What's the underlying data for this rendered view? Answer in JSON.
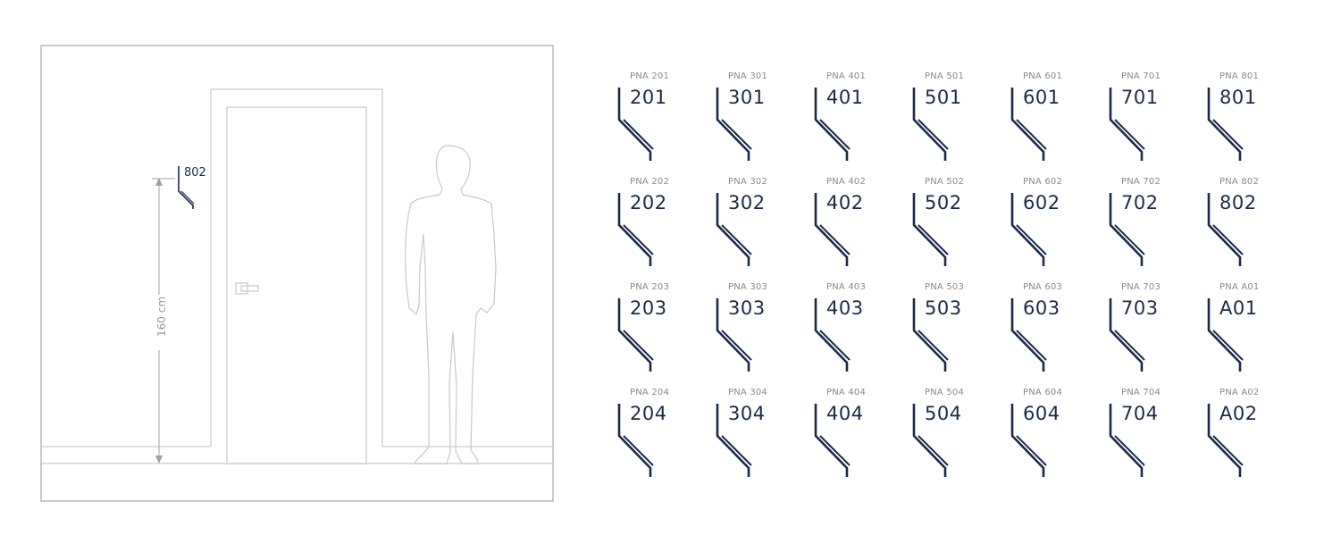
{
  "elevation": {
    "mounted_sign_number": "802",
    "height_label": "160 cm"
  },
  "signs": [
    [
      "PNA 201",
      "201"
    ],
    [
      "PNA 301",
      "301"
    ],
    [
      "PNA 401",
      "401"
    ],
    [
      "PNA 501",
      "501"
    ],
    [
      "PNA 601",
      "601"
    ],
    [
      "PNA 701",
      "701"
    ],
    [
      "PNA 801",
      "801"
    ],
    [
      "PNA 202",
      "202"
    ],
    [
      "PNA 302",
      "302"
    ],
    [
      "PNA 402",
      "402"
    ],
    [
      "PNA 502",
      "502"
    ],
    [
      "PNA 602",
      "602"
    ],
    [
      "PNA 702",
      "702"
    ],
    [
      "PNA 802",
      "802"
    ],
    [
      "PNA 203",
      "203"
    ],
    [
      "PNA 303",
      "303"
    ],
    [
      "PNA 403",
      "403"
    ],
    [
      "PNA 503",
      "503"
    ],
    [
      "PNA 603",
      "603"
    ],
    [
      "PNA 703",
      "703"
    ],
    [
      "PNA A01",
      "A01"
    ],
    [
      "PNA 204",
      "204"
    ],
    [
      "PNA 304",
      "304"
    ],
    [
      "PNA 404",
      "404"
    ],
    [
      "PNA 504",
      "504"
    ],
    [
      "PNA 604",
      "604"
    ],
    [
      "PNA 704",
      "704"
    ],
    [
      "PNA A02",
      "A02"
    ]
  ],
  "colors": {
    "sign_navy": "#1b2a48",
    "code_grey": "#8a8a8a",
    "line_grey": "#c9c9c9"
  }
}
